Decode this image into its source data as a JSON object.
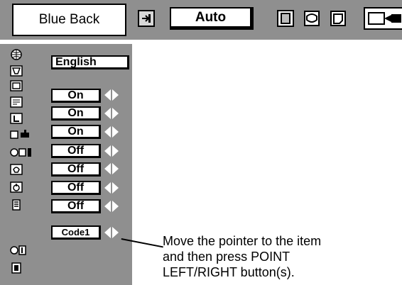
{
  "top_menu": {
    "main_value": "Blue Back",
    "auto_value": "Auto",
    "icons": [
      "input-icon",
      "auto-field",
      "square-icon",
      "screen-icon",
      "frame-icon",
      "projector-icon"
    ]
  },
  "settings": {
    "language": "English",
    "items": [
      {
        "name": "item-1",
        "value": "On"
      },
      {
        "name": "item-2",
        "value": "On"
      },
      {
        "name": "item-3",
        "value": "On"
      },
      {
        "name": "item-4",
        "value": "Off"
      },
      {
        "name": "item-5",
        "value": "Off"
      },
      {
        "name": "item-6",
        "value": "Off"
      },
      {
        "name": "item-7",
        "value": "Off"
      },
      {
        "name": "item-8",
        "value": "Code1"
      }
    ]
  },
  "callout": {
    "line1": "Move the pointer to the item",
    "line2": "and then press POINT",
    "line3": "LEFT/RIGHT button(s)."
  }
}
